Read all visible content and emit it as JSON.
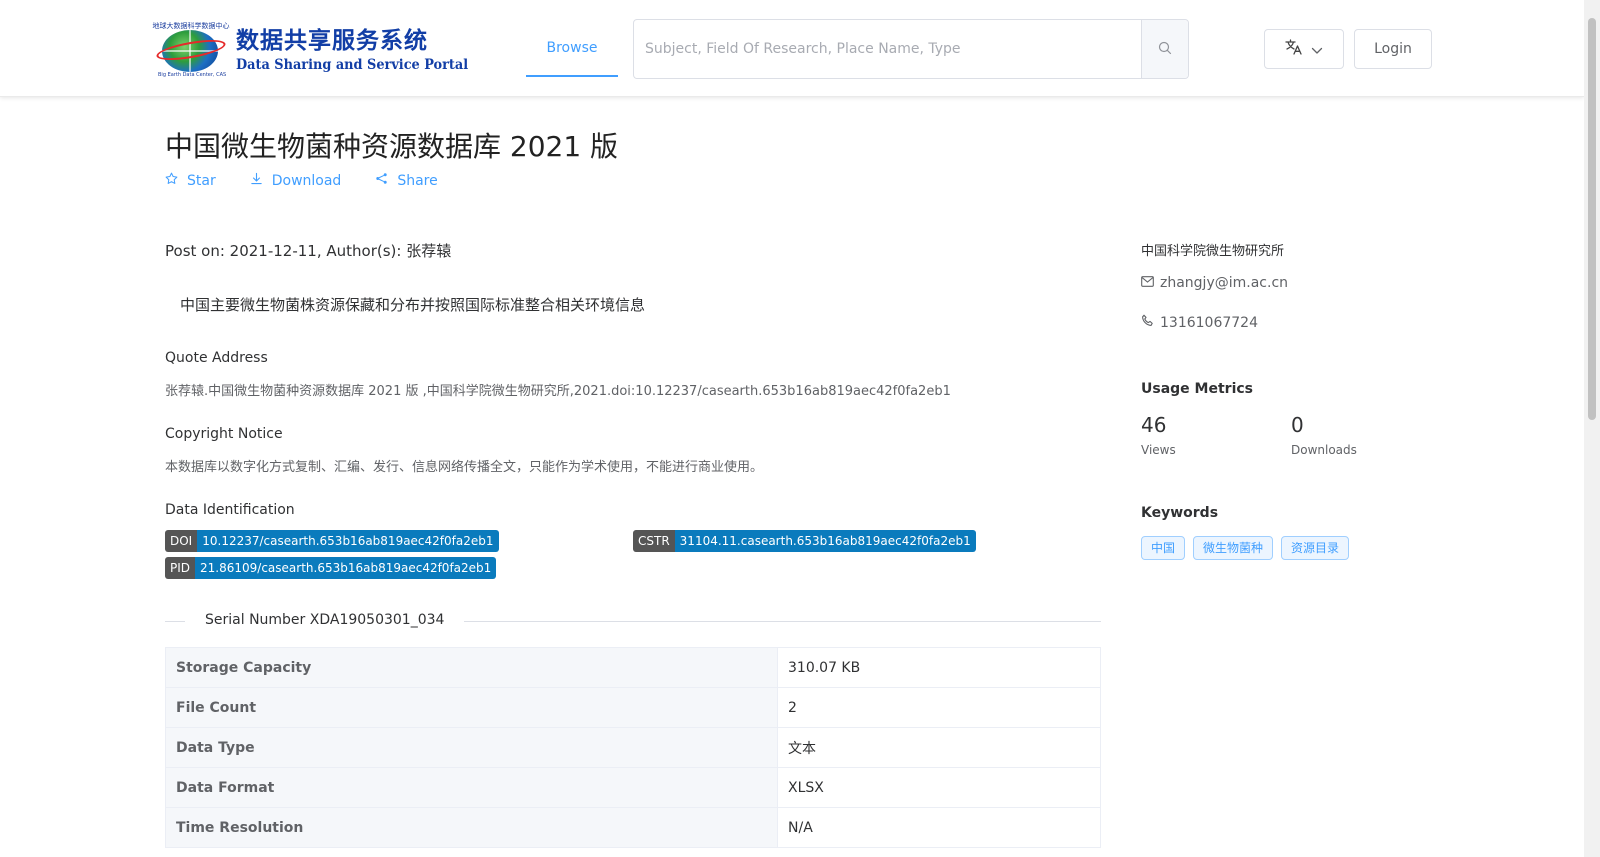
{
  "header": {
    "logo": {
      "arc_text": "地球大数据科学数据中心",
      "sub_text": "Big Earth Data Center, CAS",
      "title_cn": "数据共享服务系统",
      "title_en": "Data Sharing and Service Portal"
    },
    "nav_browse": "Browse",
    "search_placeholder": "Subject, Field Of Research, Place Name, Type",
    "login_label": "Login"
  },
  "dataset": {
    "title": "中国微生物菌种资源数据库 2021 版",
    "actions": {
      "star": "Star",
      "download": "Download",
      "share": "Share"
    },
    "post_on": "Post on: 2021-12-11, Author(s): 张荐辕",
    "description": "中国主要微生物菌株资源保藏和分布并按照国际标准整合相关环境信息",
    "quote_label": "Quote Address",
    "quote_value": "张荐辕.中国微生物菌种资源数据库 2021 版 ,中国科学院微生物研究所,2021.doi:10.12237/casearth.653b16ab819aec42f0fa2eb1",
    "copyright_label": "Copyright Notice",
    "copyright_value": "本数据库以数字化方式复制、汇编、发行、信息网络传播全文，只能作为学术使用，不能进行商业使用。",
    "identification_label": "Data Identification",
    "badges": {
      "doi": {
        "key": "DOI",
        "value": "10.12237/casearth.653b16ab819aec42f0fa2eb1"
      },
      "cstr": {
        "key": "CSTR",
        "value": "31104.11.casearth.653b16ab819aec42f0fa2eb1"
      },
      "pid": {
        "key": "PID",
        "value": "21.86109/casearth.653b16ab819aec42f0fa2eb1"
      }
    },
    "serial_number": "Serial Number XDA19050301_034",
    "table": [
      {
        "key": "Storage Capacity",
        "value": "310.07 KB"
      },
      {
        "key": "File Count",
        "value": "2"
      },
      {
        "key": "Data Type",
        "value": "文本"
      },
      {
        "key": "Data Format",
        "value": "XLSX"
      },
      {
        "key": "Time Resolution",
        "value": "N/A"
      }
    ]
  },
  "sidebar": {
    "organization": "中国科学院微生物研究所",
    "email": "zhangjy@im.ac.cn",
    "phone": "13161067724",
    "usage_heading": "Usage Metrics",
    "views_count": "46",
    "views_label": "Views",
    "downloads_count": "0",
    "downloads_label": "Downloads",
    "keywords_heading": "Keywords",
    "keywords": [
      "中国",
      "微生物菌种",
      "资源目录"
    ]
  },
  "colors": {
    "accent": "#409eff",
    "badge_key_bg": "#555555",
    "badge_value_bg": "#0a7bbd",
    "logo_blue": "#123ea6"
  }
}
